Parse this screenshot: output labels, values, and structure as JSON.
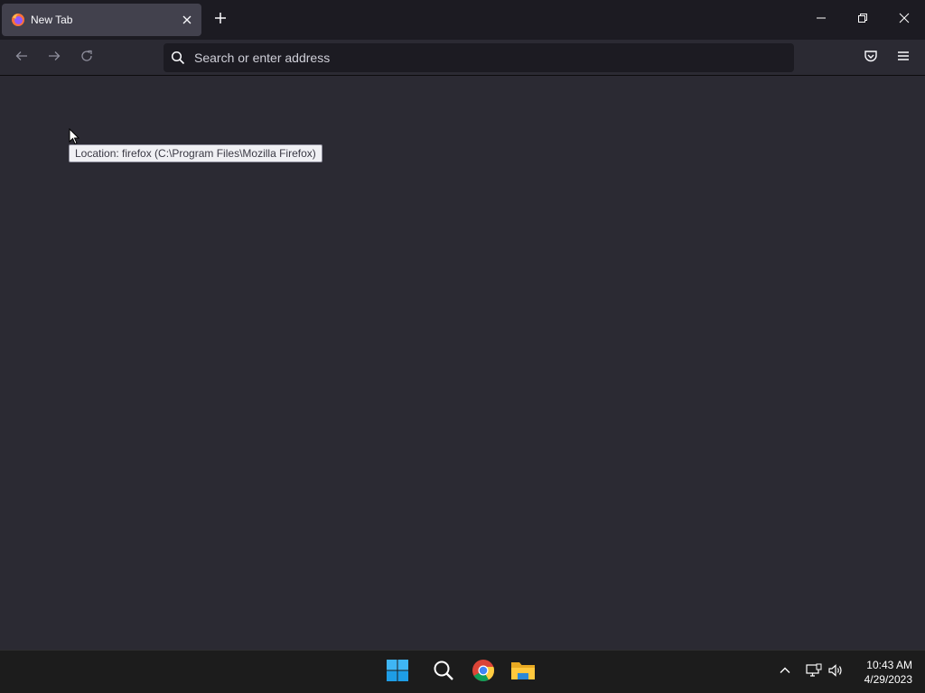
{
  "browser": {
    "tab": {
      "title": "New Tab",
      "favicon": "firefox-icon"
    },
    "new_tab_icon": "plus-icon",
    "window_controls": [
      "minimize-icon",
      "restore-icon",
      "close-icon"
    ],
    "nav": {
      "back_icon": "arrow-left-icon",
      "forward_icon": "arrow-right-icon",
      "reload_icon": "reload-icon"
    },
    "urlbar": {
      "placeholder": "Search or enter address",
      "value": "",
      "icon": "search-icon"
    },
    "toolbar_icons": [
      "pocket-icon",
      "hamburger-menu-icon"
    ]
  },
  "tooltip": {
    "text": "Location: firefox (C:\\Program Files\\Mozilla Firefox)"
  },
  "taskbar": {
    "apps": [
      "windows-start-icon",
      "search-icon",
      "chrome-icon",
      "file-explorer-icon"
    ],
    "tray_icons": [
      "chevron-up-icon",
      "network-icon",
      "volume-icon"
    ],
    "clock": {
      "time": "10:43 AM",
      "date": "4/29/2023"
    }
  },
  "colors": {
    "tabstrip_bg": "#1c1b22",
    "toolbar_bg": "#2b2a33",
    "urlbar_bg": "#1c1b22",
    "selected_tab_bg": "#42414d",
    "taskbar_bg": "#1c1c1c"
  }
}
